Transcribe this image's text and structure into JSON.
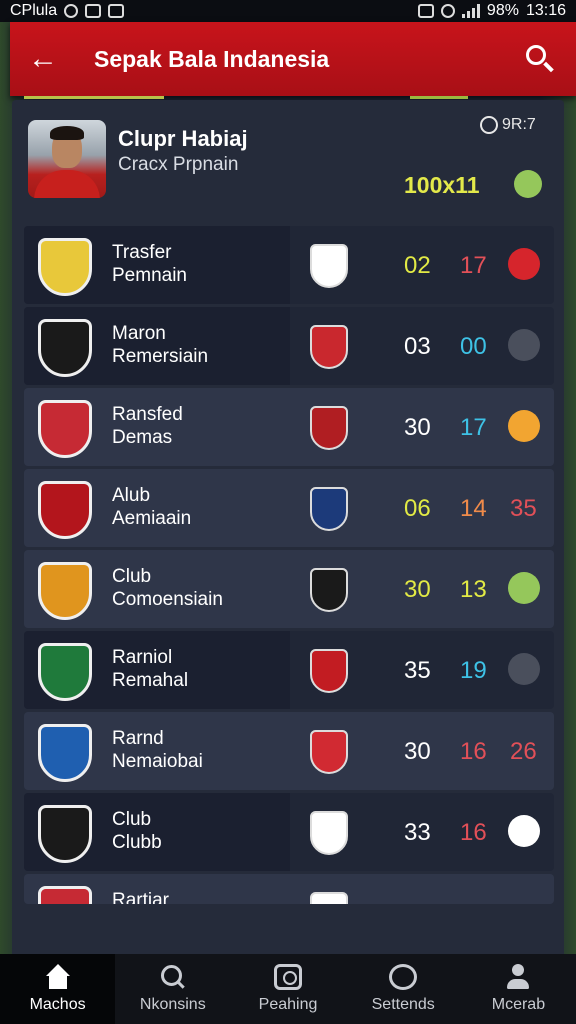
{
  "status_bar": {
    "carrier": "CPlula",
    "battery": "98%",
    "time": "13:16"
  },
  "app_bar": {
    "back_icon": "arrow-left-icon",
    "title": "Sepak Bala Indanesia",
    "search_icon": "search-icon"
  },
  "profile": {
    "name": "Clupr Habiaj",
    "subtitle": "Cracx Prpnain",
    "meta": "9R:7",
    "score": "100x11"
  },
  "rows": [
    {
      "label1": "Trasfer",
      "label2": "Pemnain",
      "v1": "02",
      "v2": "17",
      "v3": "",
      "v1_color": "#e2ea45",
      "v2_color": "#e25058",
      "badge_color": "#e8c83a",
      "opp_color": "#ffffff",
      "icon_color": "#d6252c",
      "style": "dark"
    },
    {
      "label1": "Maron",
      "label2": "Remersiain",
      "v1": "03",
      "v2": "00",
      "v3": "",
      "v1_color": "#ffffff",
      "v2_color": "#3ec2e6",
      "badge_color": "#1a1a1a",
      "opp_color": "#c9282e",
      "icon_color": "#4a4f5c",
      "style": "dark"
    },
    {
      "label1": "Ransfed",
      "label2": "Demas",
      "v1": "30",
      "v2": "17",
      "v3": "",
      "v1_color": "#ffffff",
      "v2_color": "#3ec2e6",
      "badge_color": "#c62a34",
      "opp_color": "#b01e22",
      "icon_color": "#f2a531",
      "style": "light"
    },
    {
      "label1": "Alub",
      "label2": "Aemiaain",
      "v1": "06",
      "v2": "14",
      "v3": "35",
      "v1_color": "#e2ea45",
      "v2_color": "#f08b4a",
      "v3_color": "#e25058",
      "badge_color": "#b3151c",
      "opp_color": "#1c3a7a",
      "icon_color": "",
      "style": "light"
    },
    {
      "label1": "Club",
      "label2": "Comoensiain",
      "v1": "30",
      "v2": "13",
      "v3": "",
      "v1_color": "#e2ea45",
      "v2_color": "#e2ea45",
      "badge_color": "#e0951e",
      "opp_color": "#1a1a1a",
      "icon_color": "#95c75b",
      "style": "light"
    },
    {
      "label1": "Rarniol",
      "label2": "Remahal",
      "v1": "35",
      "v2": "19",
      "v3": "",
      "v1_color": "#ffffff",
      "v2_color": "#3ec2e6",
      "badge_color": "#1f7a3b",
      "opp_color": "#c21c22",
      "icon_color": "#4a4f5c",
      "style": "dark"
    },
    {
      "label1": "Rarnd",
      "label2": "Nemaiobai",
      "v1": "30",
      "v2": "16",
      "v3": "26",
      "v1_color": "#ffffff",
      "v2_color": "#e25058",
      "v3_color": "#e25058",
      "badge_color": "#1f5fb0",
      "opp_color": "#d12a32",
      "icon_color": "",
      "style": "light"
    },
    {
      "label1": "Club",
      "label2": "Clubb",
      "v1": "33",
      "v2": "16",
      "v3": "",
      "v1_color": "#ffffff",
      "v2_color": "#e25058",
      "badge_color": "#1a1a1a",
      "opp_color": "#ffffff",
      "icon_color": "#ffffff",
      "style": "dark"
    },
    {
      "label1": "Rartiar",
      "label2": "",
      "v1": "",
      "v2": "",
      "v3": "",
      "v1_color": "#ffffff",
      "v2_color": "#ffffff",
      "badge_color": "#c62a34",
      "opp_color": "#ffffff",
      "icon_color": "",
      "style": "light"
    }
  ],
  "tabs": [
    {
      "label": "Machos",
      "icon": "home-icon",
      "active": true
    },
    {
      "label": "Nkonsins",
      "icon": "search-icon",
      "active": false
    },
    {
      "label": "Peahing",
      "icon": "camera-icon",
      "active": false
    },
    {
      "label": "Settends",
      "icon": "chat-icon",
      "active": false
    },
    {
      "label": "Mcerab",
      "icon": "user-icon",
      "active": false
    }
  ]
}
